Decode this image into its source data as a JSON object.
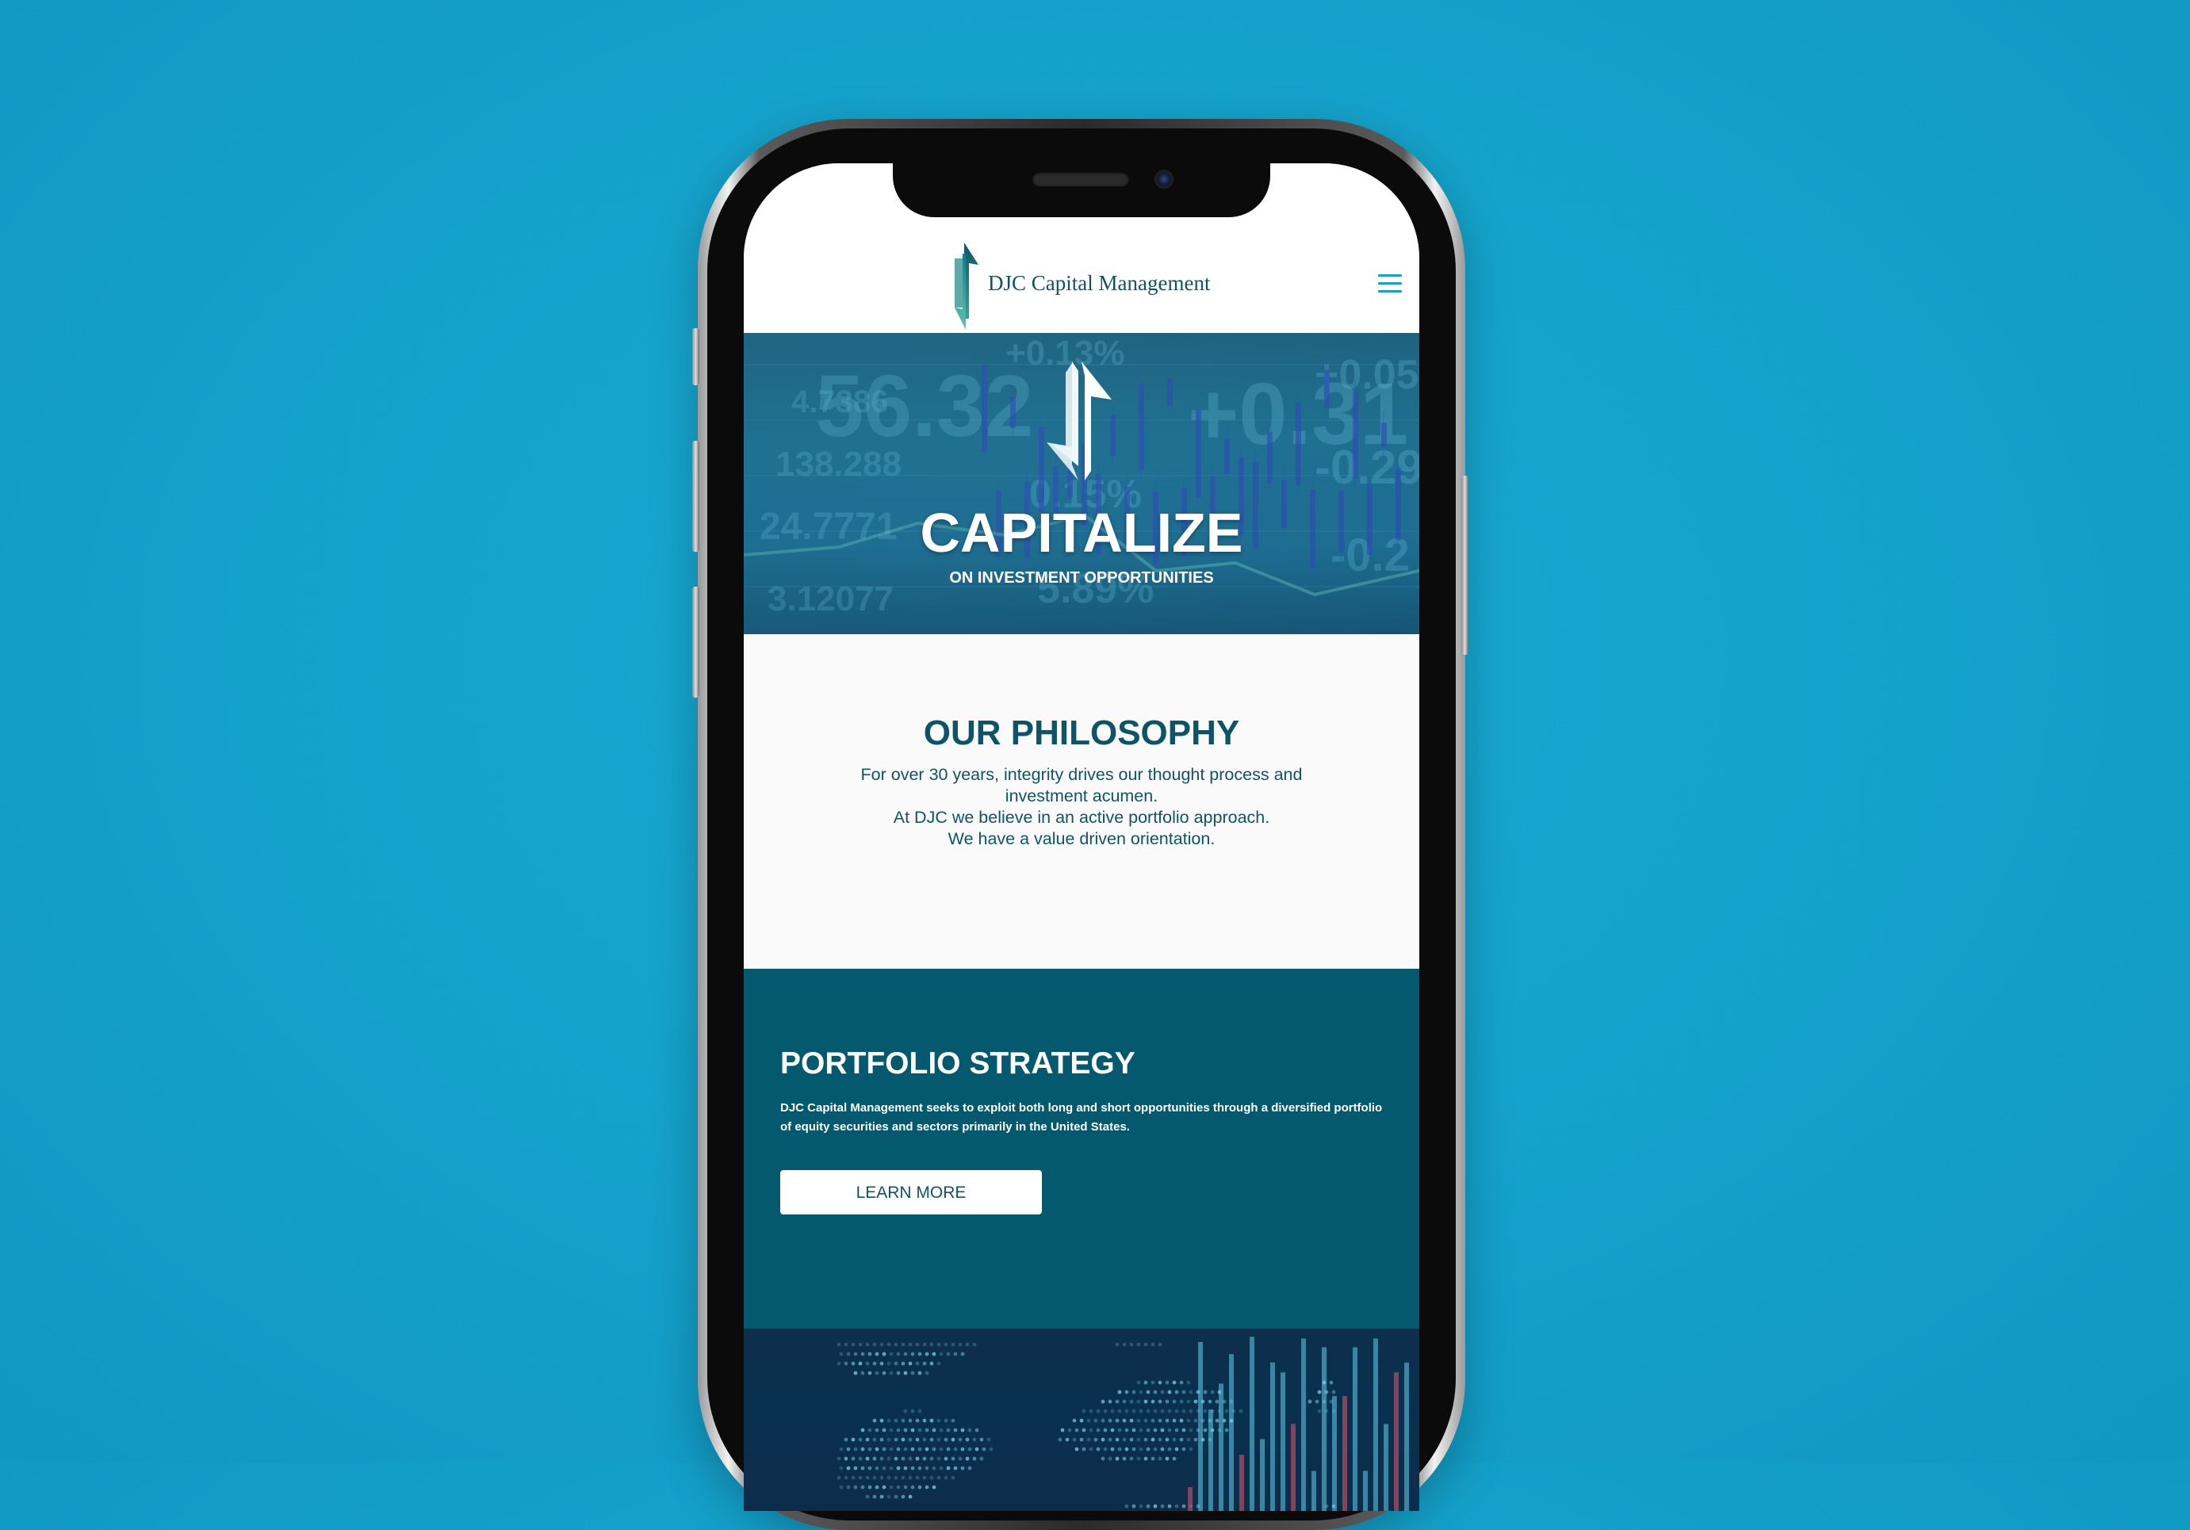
{
  "site": {
    "brand_name": "DJC Capital Management"
  },
  "header": {
    "menu_icon": "hamburger-menu-icon"
  },
  "hero": {
    "title": "CAPITALIZE",
    "subtitle": "ON INVESTMENT OPPORTUNITIES",
    "background_numbers": [
      "56.32",
      "+0.31",
      "+0.13%",
      "+0.05",
      "-0.29",
      "-0.2",
      "4.7386",
      "138.288",
      "0.15%",
      "24.7771",
      "3.12077",
      "5.89%"
    ]
  },
  "philosophy": {
    "title": "OUR PHILOSOPHY",
    "lines": [
      "For over 30 years, integrity drives our thought process and investment acumen.",
      "At DJC we believe in an active portfolio approach.",
      "We have a value driven orientation."
    ]
  },
  "strategy": {
    "title": "PORTFOLIO STRATEGY",
    "text": "DJC Capital Management seeks to exploit both long and short opportunities through a diversified portfolio of equity securities and sectors primarily in the United States.",
    "button_label": "LEARN MORE"
  },
  "colors": {
    "page_background": "#15a3cc",
    "brand_teal": "#0e5468",
    "strategy_background": "#04596e",
    "menu_accent": "#1b9fcf"
  }
}
